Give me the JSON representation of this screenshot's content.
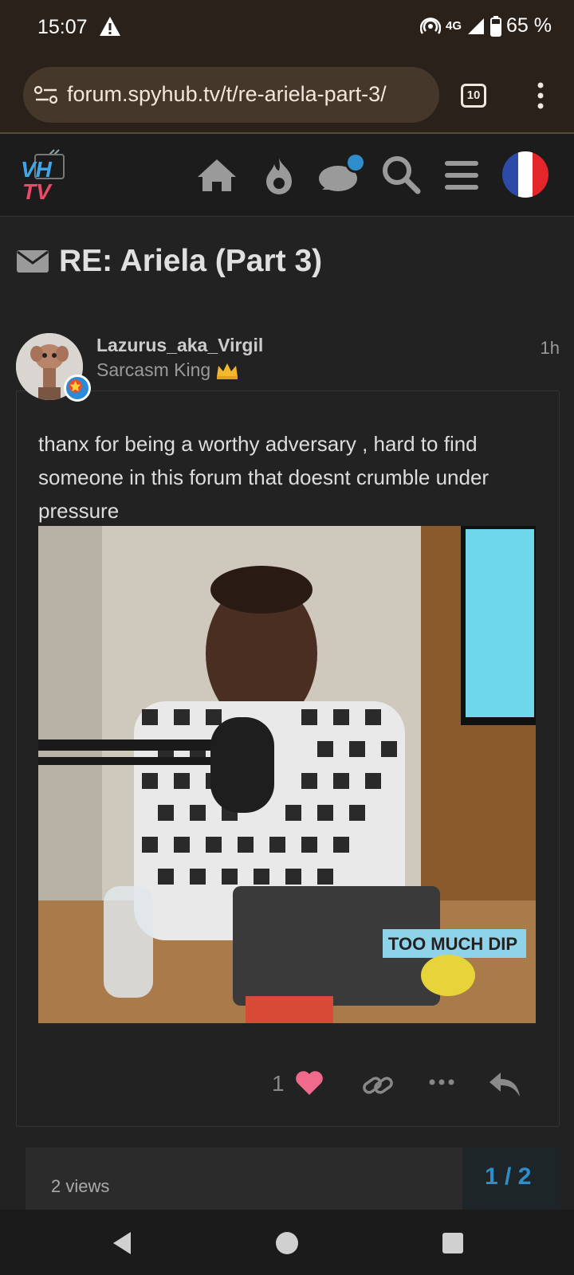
{
  "status_bar": {
    "time": "15:07",
    "network": "4G",
    "battery": "65 %",
    "icons": [
      "warning-icon",
      "hotspot-icon",
      "signal-icon",
      "battery-icon"
    ]
  },
  "browser": {
    "url": "forum.spyhub.tv/t/re-ariela-part-3/",
    "tab_count": "10"
  },
  "site_header": {
    "logo_top": "VH",
    "logo_bottom": "TV",
    "icons": [
      "home-icon",
      "hot-topics-icon",
      "chat-icon",
      "search-icon",
      "menu-icon",
      "language-flag-icon"
    ]
  },
  "topic": {
    "title": "RE: Ariela (Part 3)"
  },
  "post": {
    "username": "Lazurus_aka_Virgil",
    "user_title": "Sarcasm King",
    "time": "1h",
    "body": "thanx for being a worthy adversary , hard to find someone in this forum that doesnt crumble under pressure",
    "image_caption_text": "TOO MUCH DIP",
    "like_count": "1"
  },
  "timeline": {
    "views": "2 views",
    "pager": "1 / 2"
  },
  "colors": {
    "accent": "#2d8ecb",
    "like": "#f06b8b",
    "background": "#222222"
  }
}
